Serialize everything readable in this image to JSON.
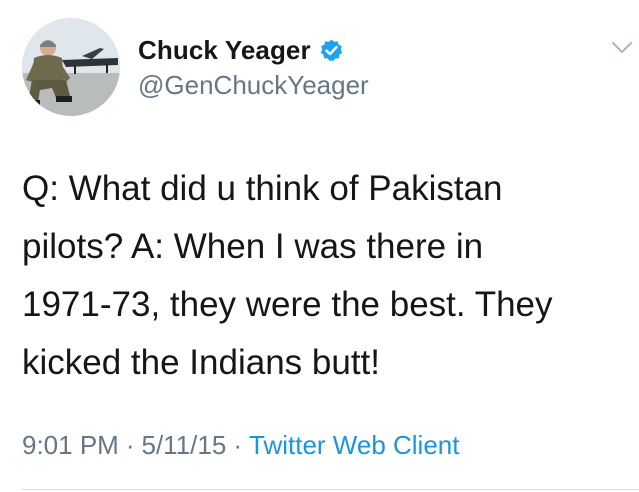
{
  "user": {
    "display_name": "Chuck Yeager",
    "handle": "@GenChuckYeager",
    "verified": true,
    "avatar_icon": "pilot-photo-avatar",
    "verified_icon": "verified-badge-icon",
    "verified_color": "#1da1f2"
  },
  "tweet": {
    "text": "Q: What did u think of Pakistan\npilots? A: When I was there in\n1971-73, they were the best. They\nkicked the Indians butt!",
    "time": "9:01 PM",
    "separator": "·",
    "date": "5/11/15",
    "client": "Twitter Web Client"
  },
  "menu": {
    "icon": "chevron-down-icon"
  },
  "colors": {
    "text": "#14171a",
    "muted": "#657786",
    "link": "#1b95e0"
  }
}
